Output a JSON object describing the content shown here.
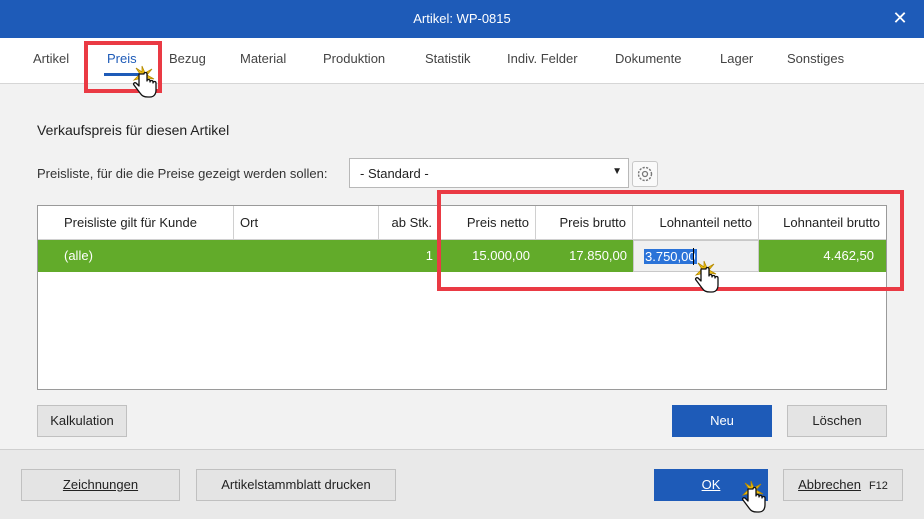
{
  "window": {
    "title": "Artikel: WP-0815"
  },
  "tabs": [
    "Artikel",
    "Preis",
    "Bezug",
    "Material",
    "Produktion",
    "Statistik",
    "Indiv. Felder",
    "Dokumente",
    "Lager",
    "Sonstiges"
  ],
  "section_title": "Verkaufspreis für diesen Artikel",
  "pricelist": {
    "label": "Preisliste, für die die Preise gezeigt werden sollen:",
    "selected": "- Standard -"
  },
  "grid": {
    "headers": [
      "Preisliste gilt für Kunde",
      "Ort",
      "ab Stk.",
      "Preis netto",
      "Preis brutto",
      "Lohnanteil netto",
      "Lohnanteil brutto"
    ],
    "rows": [
      {
        "kunde": "(alle)",
        "ort": "",
        "ab_stk": "1",
        "preis_netto": "15.000,00",
        "preis_brutto": "17.850,00",
        "lohnanteil_netto": "3.750,00",
        "lohnanteil_brutto": "4.462,50"
      }
    ]
  },
  "buttons": {
    "kalkulation": "Kalkulation",
    "neu": "Neu",
    "loeschen": "Löschen",
    "zeichnungen": "Zeichnungen",
    "artikelstammblatt": "Artikelstammblatt drucken",
    "ok": "OK",
    "abbrechen": "Abbrechen",
    "abbrechen_key": "F12"
  },
  "colors": {
    "accent": "#1e5bb8",
    "row_selected": "#62ab2a",
    "highlight": "#ea3a44"
  }
}
